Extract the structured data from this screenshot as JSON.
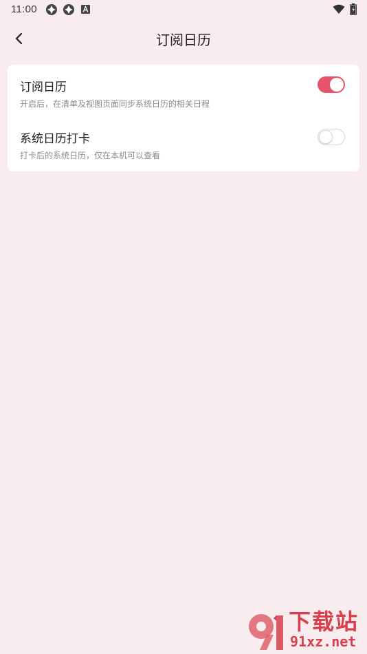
{
  "status_bar": {
    "time": "11:00",
    "icons": [
      "sync-icon",
      "sync-icon",
      "text-icon",
      "wifi-icon",
      "battery-icon"
    ]
  },
  "header": {
    "back_icon": "chevron-left-icon",
    "title": "订阅日历"
  },
  "settings": [
    {
      "title": "订阅日历",
      "description": "开启后，在清单及视图页面同步系统日历的相关日程",
      "enabled": true
    },
    {
      "title": "系统日历打卡",
      "description": "打卡后的系统日历，仅在本机可以查看",
      "enabled": false
    }
  ],
  "watermark": {
    "logo_text": "91",
    "text": "下载站",
    "url": "91xz.net"
  },
  "colors": {
    "background": "#f8ecee",
    "accent": "#e8546c",
    "card": "#ffffff",
    "watermark": "#d8404f"
  }
}
